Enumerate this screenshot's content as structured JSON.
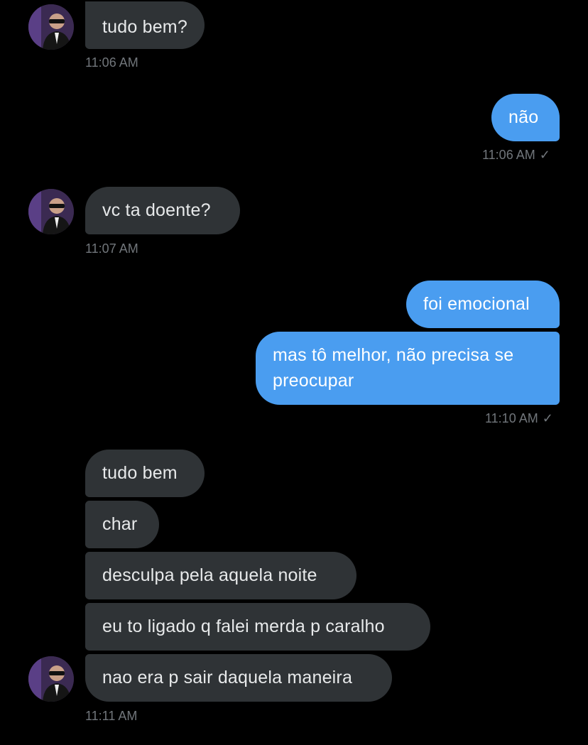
{
  "conversation": {
    "groups": [
      {
        "messages": [
          "tudo bem?"
        ],
        "time": "11:06 AM"
      },
      {
        "messages": [
          "não"
        ],
        "time": "11:06 AM"
      },
      {
        "messages": [
          "vc ta doente?"
        ],
        "time": "11:07 AM"
      },
      {
        "messages": [
          "foi emocional",
          "mas tô melhor, não precisa se preocupar"
        ],
        "time": "11:10 AM"
      },
      {
        "messages": [
          "tudo bem",
          "char",
          "desculpa pela aquela noite",
          "eu to ligado q falei merda p caralho",
          "nao era p sair daquela maneira"
        ],
        "time": "11:11 AM"
      }
    ],
    "read_check": "✓"
  },
  "colors": {
    "background": "#000000",
    "incoming_bubble": "#2f3336",
    "outgoing_bubble": "#4a9df0",
    "timestamp": "#71767b"
  },
  "icons": {
    "avatar": "avatar-icon",
    "read_check": "check-icon"
  }
}
